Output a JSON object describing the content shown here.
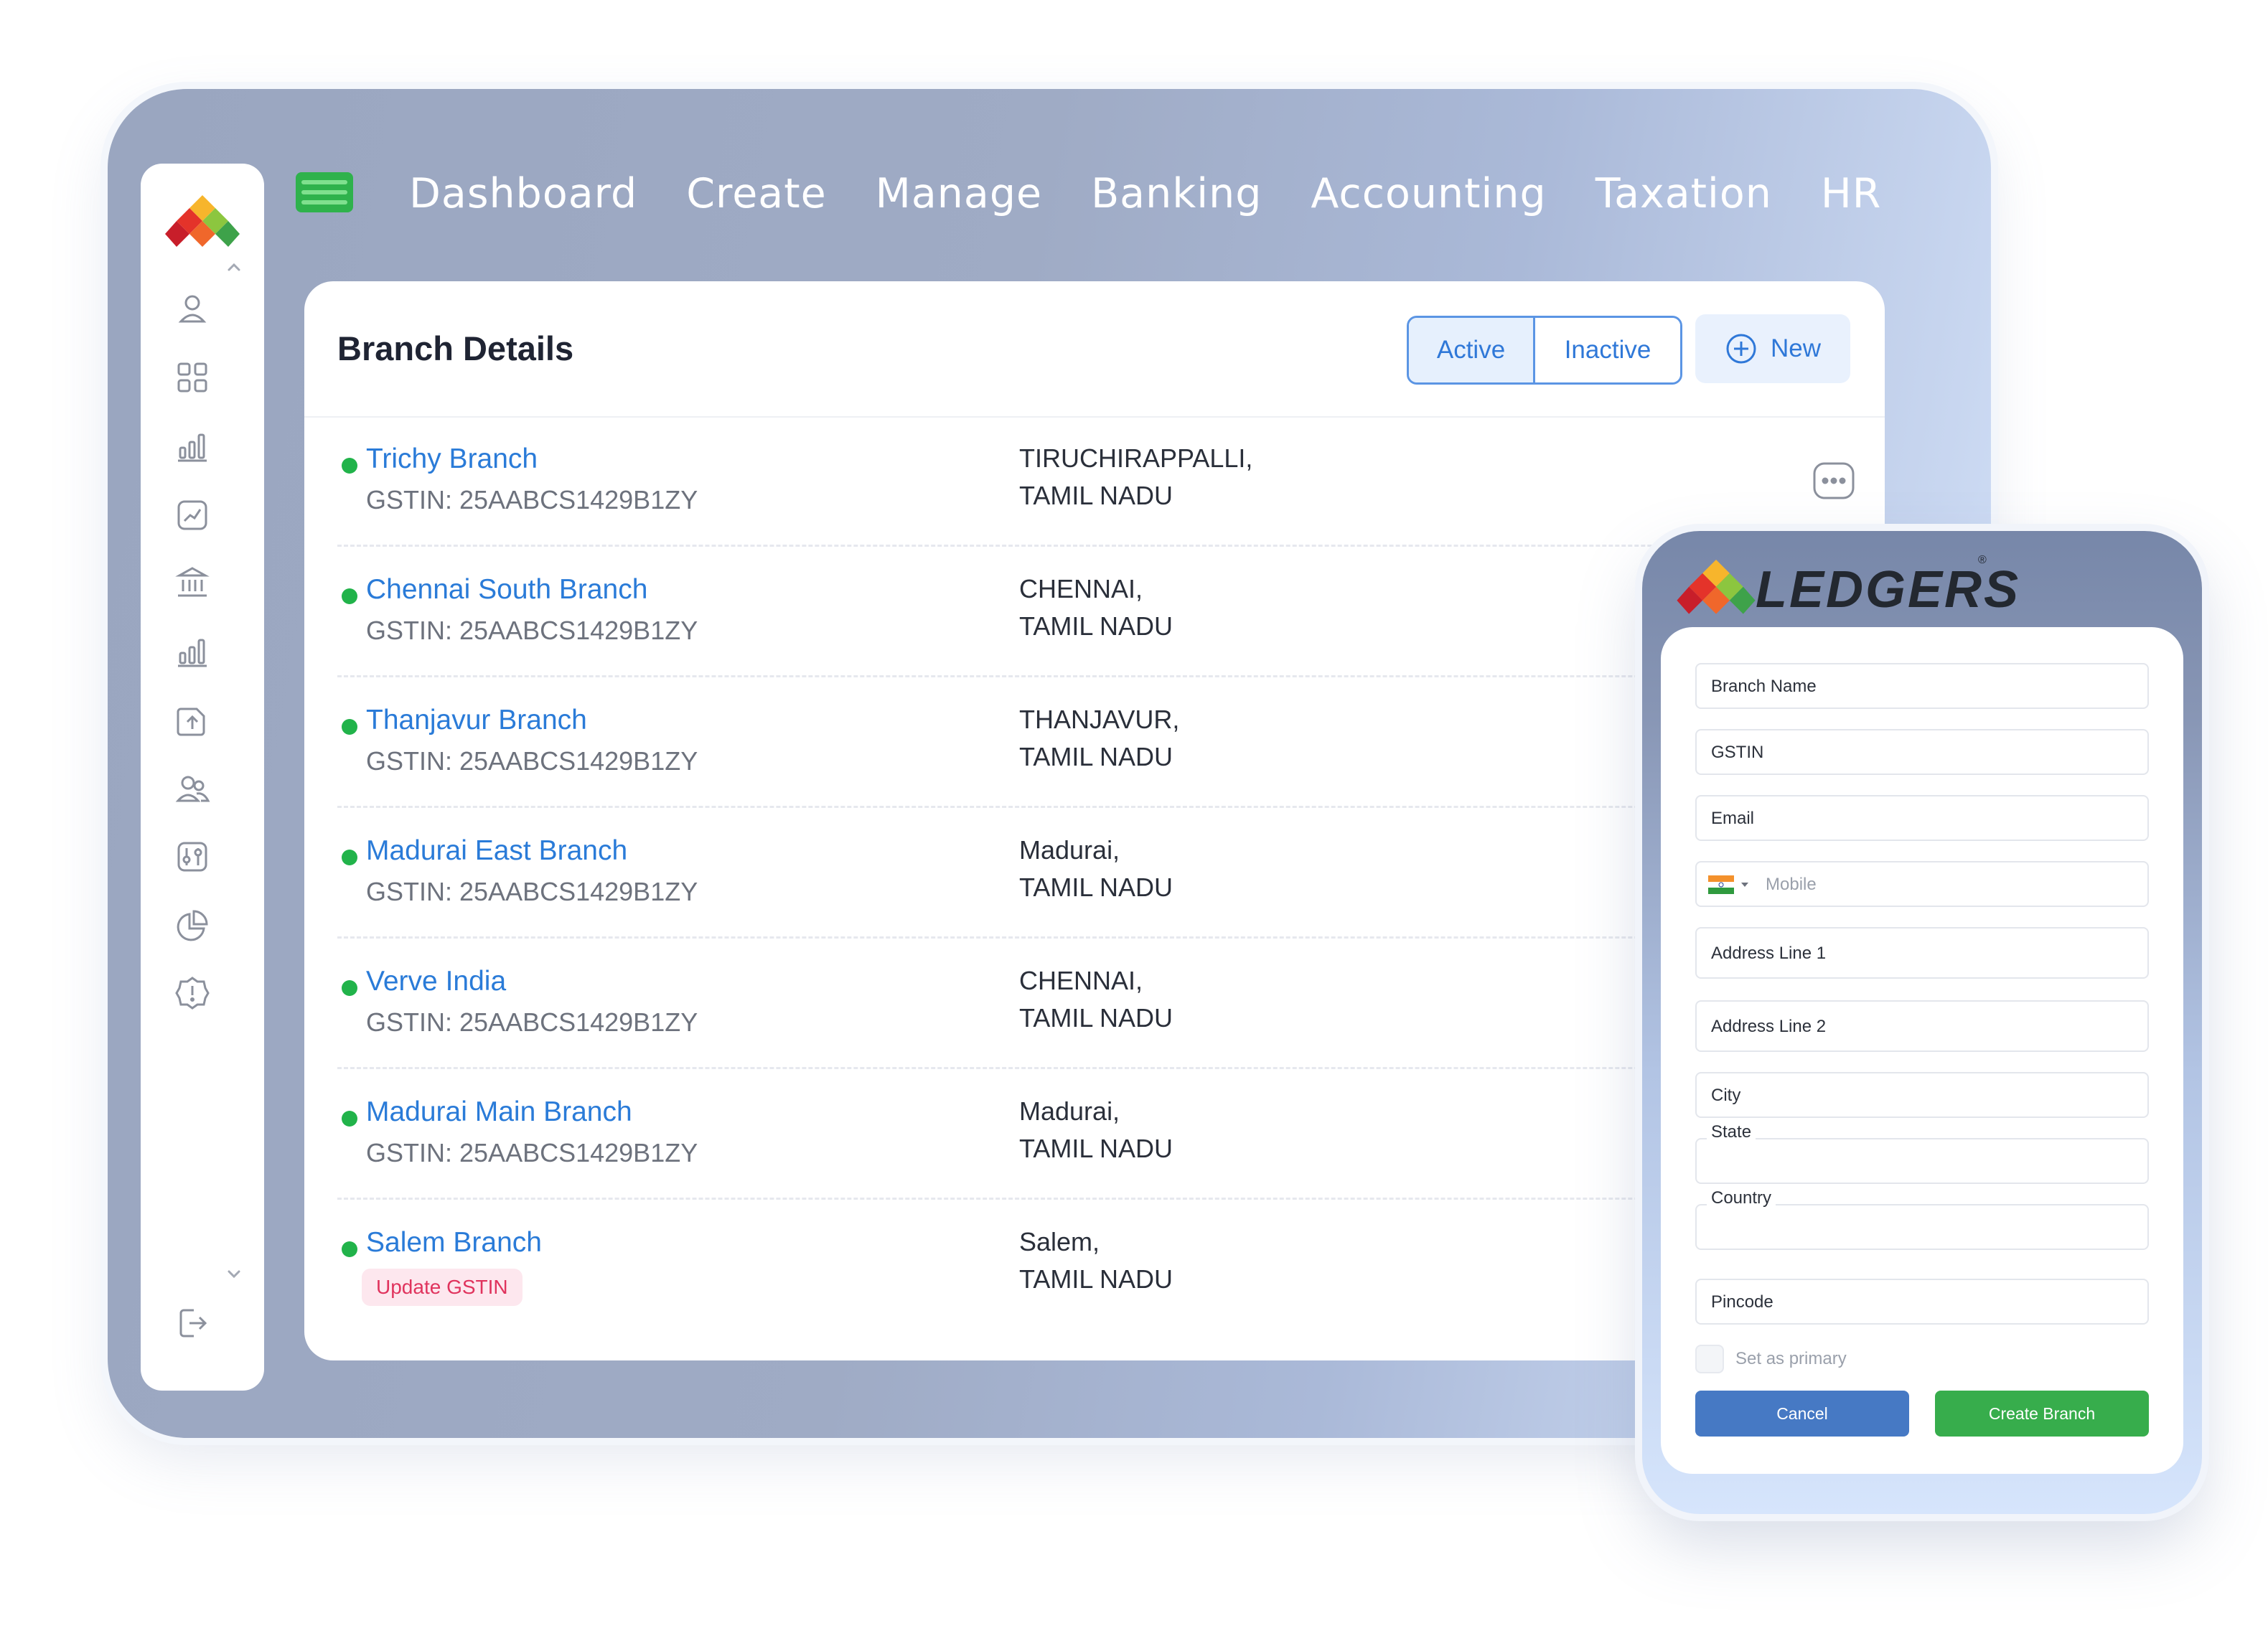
{
  "nav": {
    "items": [
      "Dashboard",
      "Create",
      "Manage",
      "Banking",
      "Accounting",
      "Taxation",
      "HR"
    ]
  },
  "sidebar": {
    "icons": [
      "user-icon",
      "grid-icon",
      "bar-chart-icon",
      "report-chart-icon",
      "bank-icon",
      "bar-chart-icon",
      "upload-document-icon",
      "users-icon",
      "settings-panel-icon",
      "pie-chart-icon",
      "alert-badge-icon"
    ],
    "bottom_icon": "logout-icon"
  },
  "branch_panel": {
    "title": "Branch Details",
    "filter": {
      "active_label": "Active",
      "inactive_label": "Inactive",
      "selected": "Active"
    },
    "new_label": "New",
    "branches": [
      {
        "name": "Trichy Branch",
        "gstin": "GSTIN: 25AABCS1429B1ZY",
        "city": "TIRUCHIRAPPALLI,",
        "state": "TAMIL NADU",
        "status": "active"
      },
      {
        "name": "Chennai South Branch",
        "gstin": "GSTIN: 25AABCS1429B1ZY",
        "city": "CHENNAI,",
        "state": "TAMIL NADU",
        "status": "active"
      },
      {
        "name": "Thanjavur Branch",
        "gstin": "GSTIN: 25AABCS1429B1ZY",
        "city": "THANJAVUR,",
        "state": "TAMIL NADU",
        "status": "active"
      },
      {
        "name": "Madurai East Branch",
        "gstin": "GSTIN: 25AABCS1429B1ZY",
        "city": "Madurai,",
        "state": "TAMIL NADU",
        "status": "active"
      },
      {
        "name": "Verve India",
        "gstin": "GSTIN: 25AABCS1429B1ZY",
        "city": "CHENNAI,",
        "state": "TAMIL NADU",
        "status": "active"
      },
      {
        "name": "Madurai Main Branch",
        "gstin": "GSTIN: 25AABCS1429B1ZY",
        "city": "Madurai,",
        "state": "TAMIL NADU",
        "status": "active"
      },
      {
        "name": "Salem Branch",
        "badge": "Update GSTIN",
        "city": "Salem,",
        "state": "TAMIL NADU",
        "status": "active"
      }
    ]
  },
  "form": {
    "brand": "LEDGERS",
    "brand_mark": "®",
    "fields": {
      "branch_name": "Branch Name",
      "gstin": "GSTIN",
      "email": "Email",
      "mobile_placeholder": "Mobile",
      "address_line_1": "Address Line 1",
      "address_line_2": "Address Line 2",
      "city": "City",
      "state": "State",
      "country": "Country",
      "pincode": "Pincode"
    },
    "set_primary_label": "Set as primary",
    "cancel_label": "Cancel",
    "create_label": "Create Branch"
  },
  "colors": {
    "accent_blue": "#2a7bd8",
    "status_green": "#21b34a",
    "badge_red": "#e0335d",
    "create_green": "#37ad4c",
    "cancel_blue": "#4679c4"
  }
}
